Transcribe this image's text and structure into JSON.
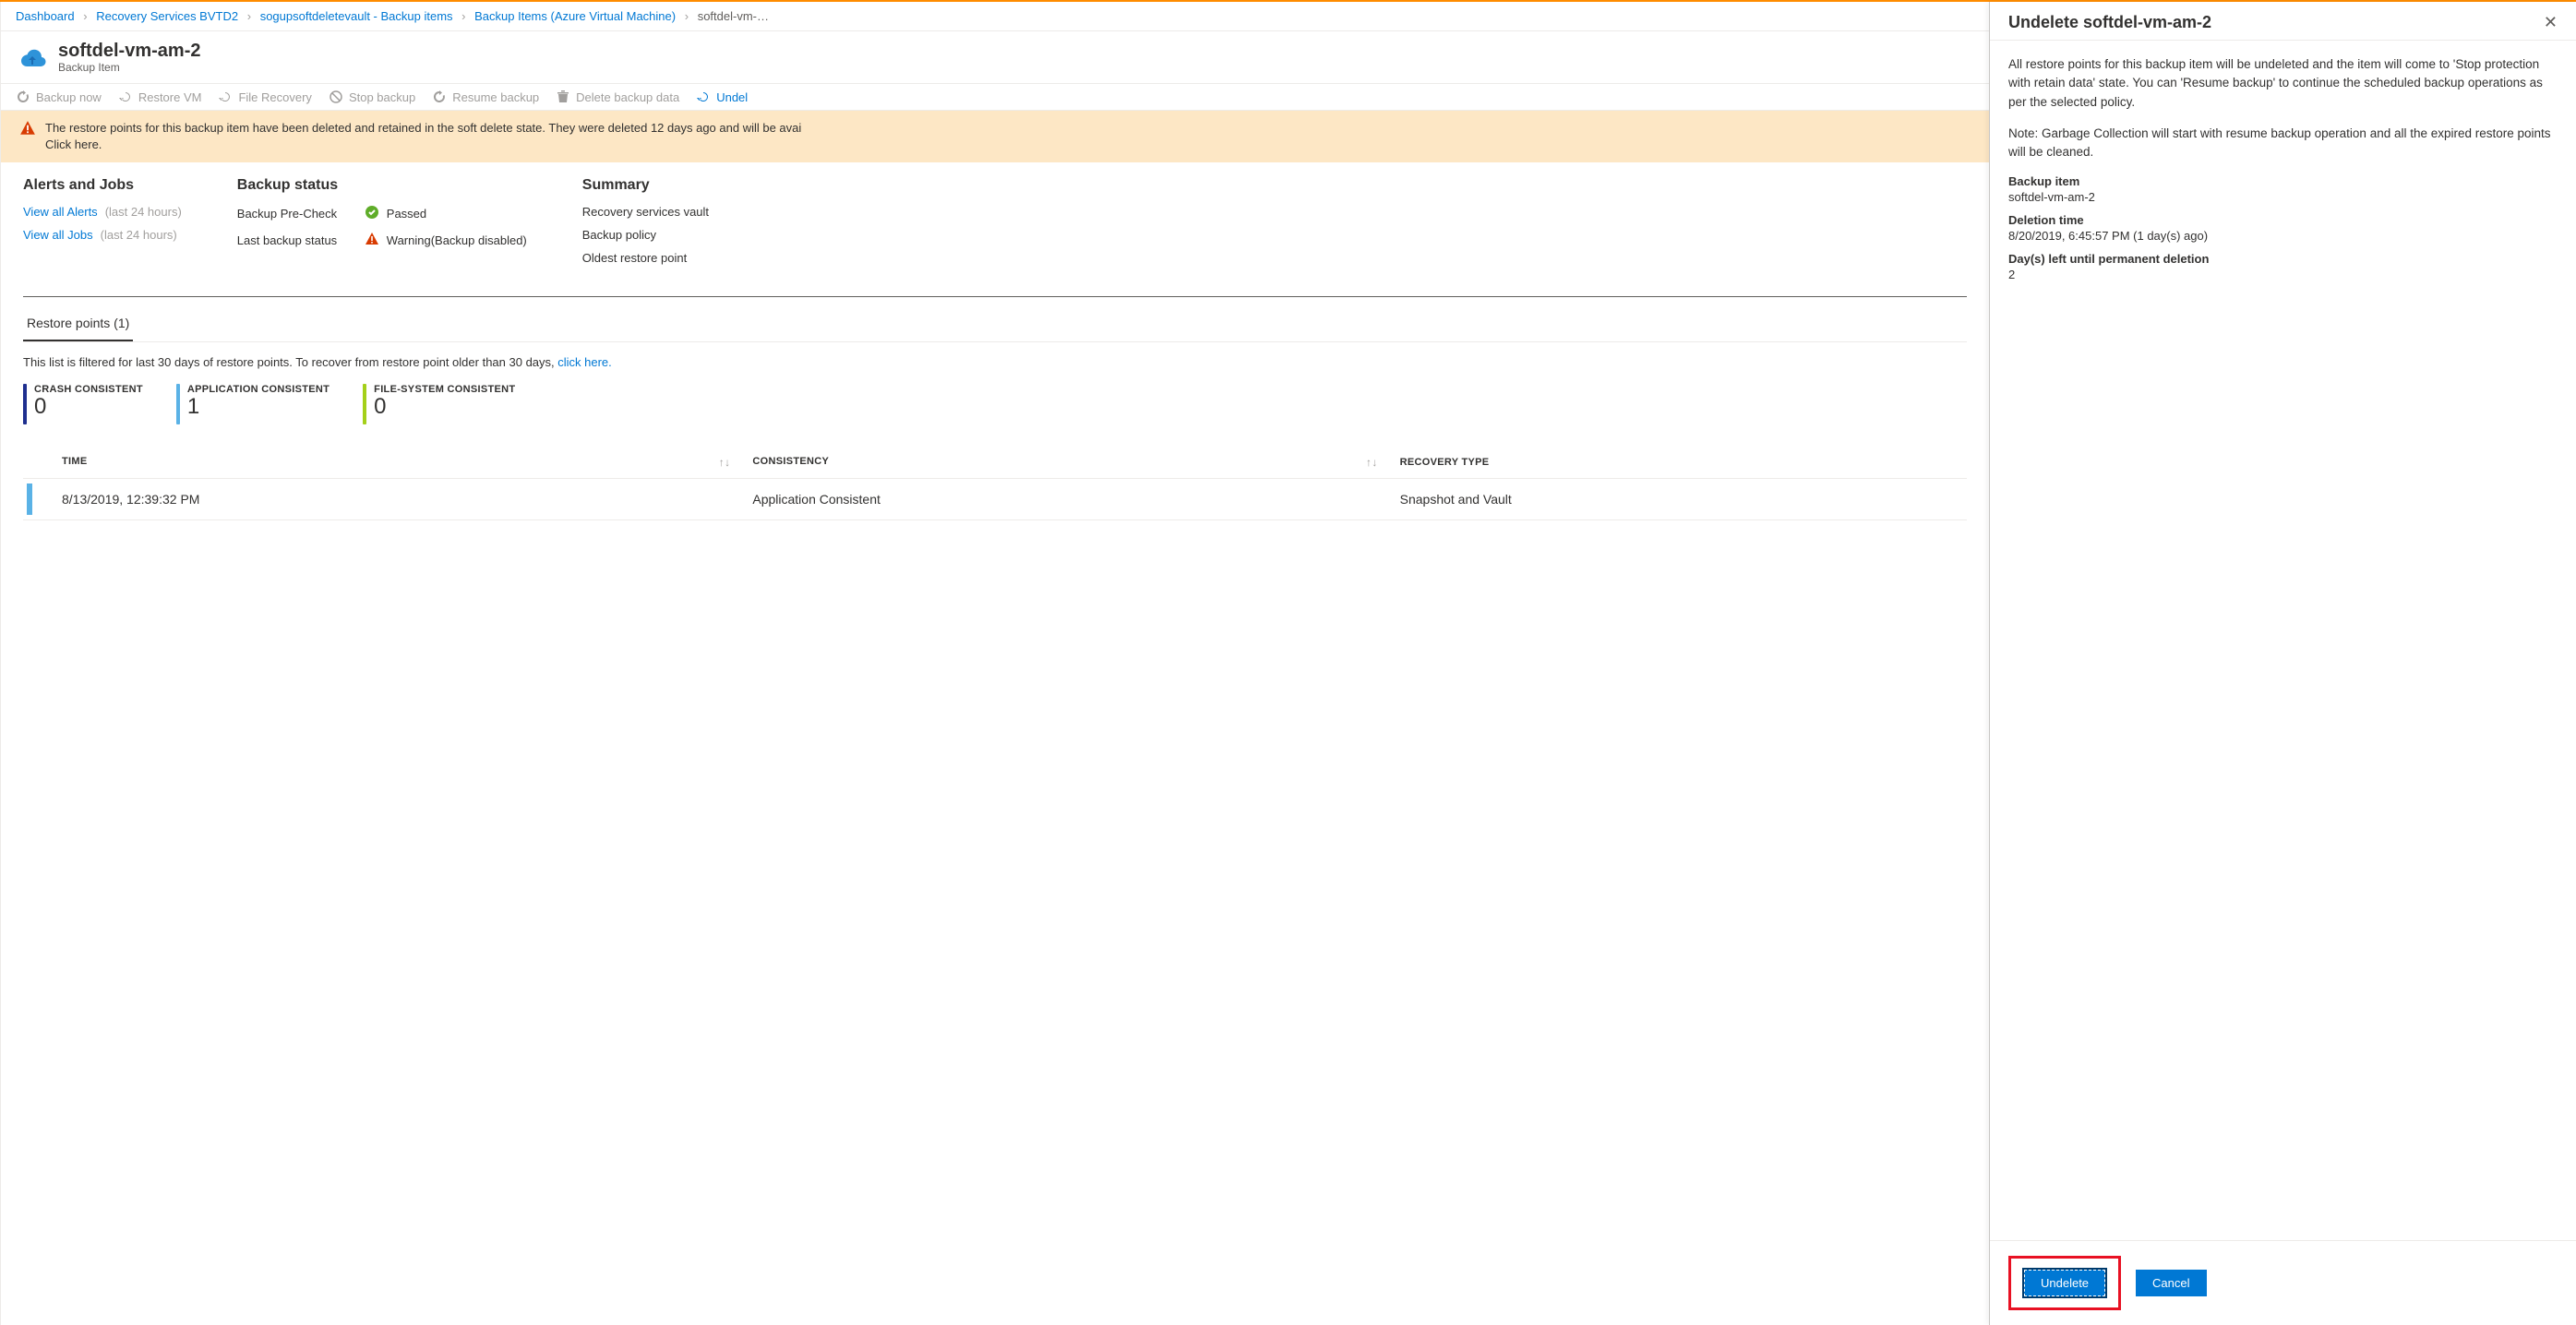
{
  "breadcrumb": {
    "items": [
      "Dashboard",
      "Recovery Services BVTD2",
      "sogupsoftdeletevault - Backup items",
      "Backup Items (Azure Virtual Machine)"
    ],
    "current": "softdel-vm-…"
  },
  "header": {
    "title": "softdel-vm-am-2",
    "subtitle": "Backup Item"
  },
  "toolbar": {
    "backup_now": "Backup now",
    "restore_vm": "Restore VM",
    "file_recovery": "File Recovery",
    "stop_backup": "Stop backup",
    "resume_backup": "Resume backup",
    "delete_backup_data": "Delete backup data",
    "undelete": "Undel"
  },
  "banner": {
    "text": "The restore points for this backup item have been deleted and retained in the soft delete state. They were deleted 12 days ago and will be avai",
    "link": "Click here."
  },
  "sections": {
    "alerts": {
      "title": "Alerts and Jobs",
      "view_alerts": "View all Alerts",
      "view_jobs": "View all Jobs",
      "hours24": "(last 24 hours)"
    },
    "backup_status": {
      "title": "Backup status",
      "precheck_label": "Backup Pre-Check",
      "precheck_value": "Passed",
      "lastbackup_label": "Last backup status",
      "lastbackup_value": "Warning(Backup disabled)"
    },
    "summary": {
      "title": "Summary",
      "rsv": "Recovery services vault",
      "policy": "Backup policy",
      "oldest": "Oldest restore point"
    }
  },
  "tabs": {
    "restore_points": "Restore points (1)"
  },
  "filter_text": {
    "prefix": "This list is filtered for last 30 days of restore points. To recover from restore point older than 30 days, ",
    "link": "click here."
  },
  "stats": {
    "crash": {
      "label": "CRASH CONSISTENT",
      "value": "0"
    },
    "app": {
      "label": "APPLICATION CONSISTENT",
      "value": "1"
    },
    "fs": {
      "label": "FILE-SYSTEM CONSISTENT",
      "value": "0"
    }
  },
  "table": {
    "headers": {
      "time": "TIME",
      "consistency": "CONSISTENCY",
      "recovery_type": "RECOVERY TYPE"
    },
    "rows": [
      {
        "time": "8/13/2019, 12:39:32 PM",
        "consistency": "Application Consistent",
        "recovery_type": "Snapshot and Vault"
      }
    ]
  },
  "panel": {
    "title": "Undelete softdel-vm-am-2",
    "para1": "All restore points for this backup item will be undeleted and the item will come to 'Stop protection with retain data' state. You can 'Resume backup' to continue the scheduled backup operations as per the selected policy.",
    "para2": "Note: Garbage Collection will start with resume backup operation and all the expired restore points will be cleaned.",
    "backup_item_label": "Backup item",
    "backup_item_value": "softdel-vm-am-2",
    "deletion_time_label": "Deletion time",
    "deletion_time_value": "8/20/2019, 6:45:57 PM (1 day(s) ago)",
    "days_left_label": "Day(s) left until permanent deletion",
    "days_left_value": "2",
    "undelete_btn": "Undelete",
    "cancel_btn": "Cancel"
  }
}
